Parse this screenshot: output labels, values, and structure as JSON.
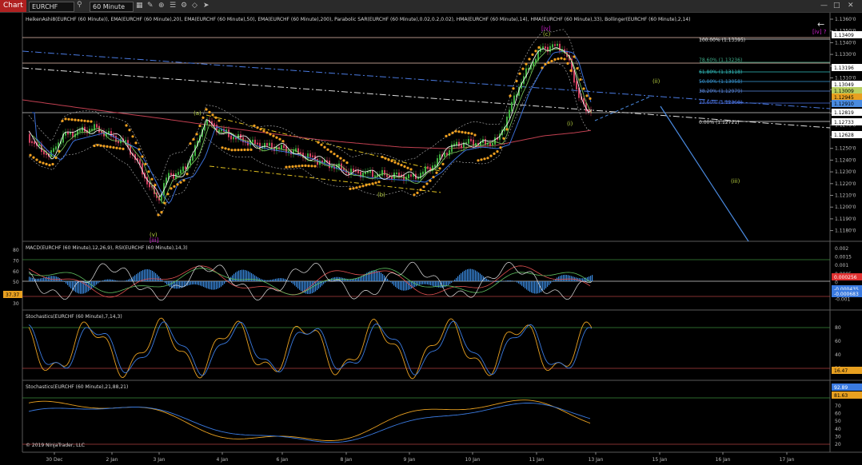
{
  "toolbar": {
    "tab": "Chart",
    "instrument": "EURCHF",
    "interval": "60 Minute",
    "icons": [
      "search-icon",
      "bar-chart-icon",
      "pencil-icon",
      "zoom-icon",
      "layers-icon",
      "properties-icon",
      "lock-icon",
      "cursor-icon",
      "minimize-icon",
      "maximize-icon",
      "close-icon"
    ]
  },
  "panels": {
    "price": {
      "title": "HeikenAshi8(EURCHF (60 Minute)), EMA(EURCHF (60 Minute),20), EMA(EURCHF (60 Minute),50), EMA(EURCHF (60 Minute),200), Parabolic SAR(EURCHF (60 Minute),0.02,0.2,0.02), HMA(EURCHF (60 Minute),14), HMA(EURCHF (60 Minute),33), Bollinger(EURCHF (60 Minute),2,14)",
      "ticks": [
        "1.1360'0",
        "1.1350'0",
        "1.1340'0",
        "1.1330'0",
        "1.1320'0",
        "1.1310'0",
        "1.1300'0",
        "1.1290'0",
        "1.1280'0",
        "1.1270'0",
        "1.1260'0",
        "1.1250'0",
        "1.1240'0",
        "1.1230'0",
        "1.1220'0",
        "1.1210'0",
        "1.1200'0",
        "1.1190'0",
        "1.1180'0"
      ],
      "price_markers": [
        {
          "label": "1.13409",
          "color": "#ffffff",
          "text_color": "#000000"
        },
        {
          "label": "1.13196",
          "color": "#ffffff",
          "text_color": "#000000"
        },
        {
          "label": "1.13049",
          "color": "#ffffff",
          "text_color": "#000000"
        },
        {
          "label": "1.13009",
          "color": "#b8d060",
          "text_color": "#000000"
        },
        {
          "label": "1.12945",
          "color": "#e8a020",
          "text_color": "#000000"
        },
        {
          "label": "1.12910",
          "color": "#4a8be0",
          "text_color": "#000000"
        },
        {
          "label": "1.12819",
          "color": "#ffffff",
          "text_color": "#000000"
        },
        {
          "label": "1.12733",
          "color": "#ffffff",
          "text_color": "#000000"
        },
        {
          "label": "1.12628",
          "color": "#ffffff",
          "text_color": "#000000"
        }
      ],
      "wave_labels": [
        "[iv]",
        "(c)",
        "(a)",
        "(b)",
        "(v)",
        "[iii]",
        "(ii)",
        "(i)",
        "(iii)",
        "[iv] ?"
      ],
      "fib_levels": [
        {
          "label": "100.00% (1.13395)",
          "color": "#e0e0e0"
        },
        {
          "label": "78.60% (1.13236)",
          "color": "#3fae8a"
        },
        {
          "label": "61.80% (1.13118)",
          "color": "#33c0c0"
        },
        {
          "label": "50.00% (1.13058)",
          "color": "#3a9ad8"
        },
        {
          "label": "38.20% (1.12979)",
          "color": "#5a8ae0"
        },
        {
          "label": "23.60% (1.12860)",
          "color": "#4a70e0"
        },
        {
          "label": "0.00% (1.12721)",
          "color": "#e0e0e0"
        }
      ]
    },
    "macd": {
      "title": "MACD(EURCHF (60 Minute),12,26,9), RSI(EURCHF (60 Minute),14,3)",
      "left_ticks": [
        "80",
        "70",
        "60",
        "50",
        "40",
        "30"
      ],
      "right_ticks": [
        "0.002",
        "0.0015",
        "0.001",
        "0.0005",
        "0",
        "-0.0005",
        "-0.001"
      ],
      "markers": [
        {
          "label": "0.000256",
          "color": "#e03030",
          "text_color": "#ffffff"
        },
        {
          "label": "-0.000435",
          "color": "#3a7ae0",
          "text_color": "#ffffff"
        },
        {
          "label": "-0.000683",
          "color": "#3a7ae0",
          "text_color": "#ffffff"
        }
      ],
      "rsi_marker": {
        "label": "37.37",
        "color": "#e8a020",
        "text_color": "#000000"
      }
    },
    "stoch1": {
      "title": "Stochastics(EURCHF (60 Minute),7,14,3)",
      "ticks": [
        "80",
        "60",
        "40",
        "20"
      ],
      "marker": {
        "label": "16.47",
        "color": "#e8a020",
        "text_color": "#000000"
      }
    },
    "stoch2": {
      "title": "Stochastics(EURCHF (60 Minute),21,88,21)",
      "ticks": [
        "70",
        "60",
        "50",
        "40",
        "30",
        "20"
      ],
      "markers": [
        {
          "label": "92.89",
          "color": "#3a7ae0",
          "text_color": "#ffffff"
        },
        {
          "label": "81.63",
          "color": "#e8a020",
          "text_color": "#000000"
        }
      ],
      "copyright": "© 2019 NinjaTrader, LLC"
    }
  },
  "x_axis": [
    "30 Dec",
    "2 Jan",
    "3 Jan",
    "4 Jan",
    "6 Jan",
    "8 Jan",
    "9 Jan",
    "10 Jan",
    "11 Jan",
    "13 Jan",
    "15 Jan",
    "16 Jan",
    "17 Jan"
  ],
  "colors": {
    "ema20": "#3a6fd8",
    "ema200": "#c04050",
    "sar": "#f0a020",
    "hma": "#ffffff",
    "bb": "#bbbbbb",
    "up": "#3fae3f",
    "down": "#d04060"
  },
  "chart_data": {
    "type": "candlestick",
    "title": "EURCHF 60 Minute",
    "ylim": [
      1.118,
      1.136
    ],
    "x_categories": [
      "30 Dec",
      "2 Jan",
      "3 Jan",
      "4 Jan",
      "6 Jan",
      "8 Jan",
      "9 Jan",
      "10 Jan",
      "11 Jan",
      "13 Jan"
    ],
    "series": [
      {
        "name": "HeikenAshi8 close (approx)",
        "values": [
          1.1265,
          1.1262,
          1.1195,
          1.1278,
          1.126,
          1.1248,
          1.1228,
          1.1255,
          1.1335,
          1.1282
        ]
      },
      {
        "name": "EMA 20 (approx)",
        "values": [
          1.126,
          1.1258,
          1.1228,
          1.1268,
          1.1262,
          1.125,
          1.1232,
          1.1245,
          1.13,
          1.13
        ]
      },
      {
        "name": "EMA 200 (approx)",
        "values": [
          1.1285,
          1.128,
          1.1272,
          1.1267,
          1.1262,
          1.1257,
          1.1252,
          1.1252,
          1.1257,
          1.1265
        ]
      }
    ],
    "fib_retracement": [
      {
        "pct": "100.00%",
        "price": 1.13395
      },
      {
        "pct": "78.60%",
        "price": 1.13236
      },
      {
        "pct": "61.80%",
        "price": 1.13118
      },
      {
        "pct": "50.00%",
        "price": 1.13058
      },
      {
        "pct": "38.20%",
        "price": 1.12979
      },
      {
        "pct": "23.60%",
        "price": 1.1286
      },
      {
        "pct": "0.00%",
        "price": 1.12721
      }
    ]
  }
}
